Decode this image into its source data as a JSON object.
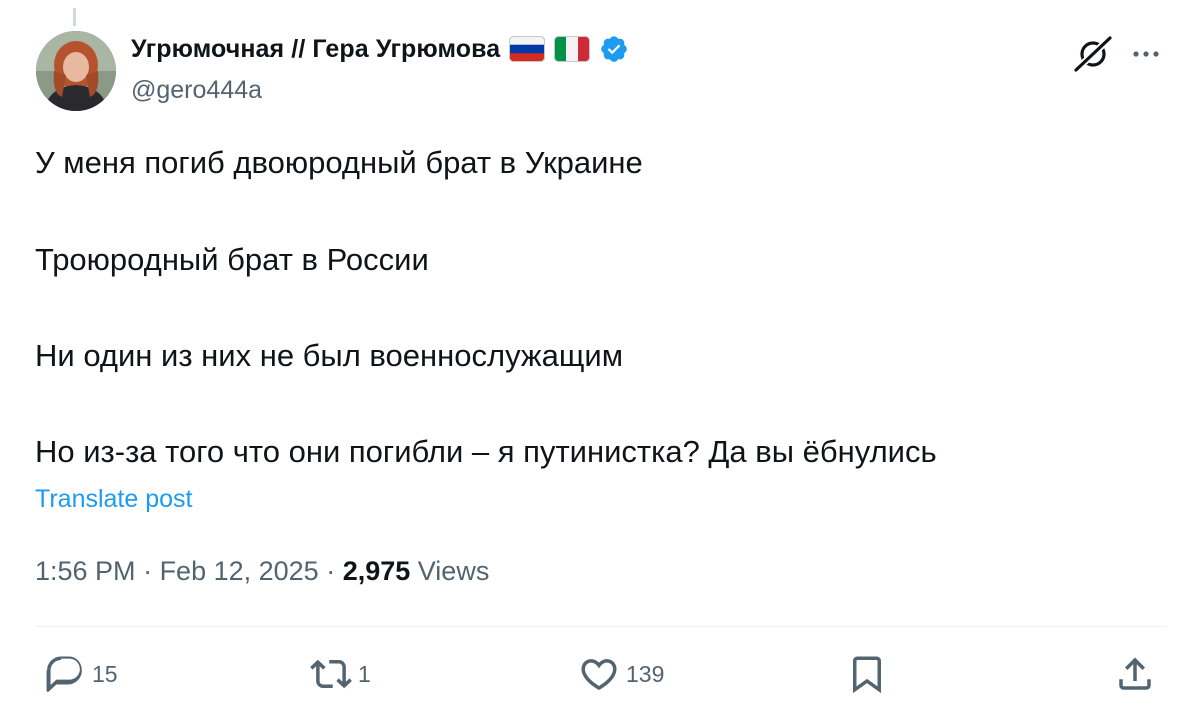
{
  "author": {
    "display_name": "Угрюмочная // Гера Угрюмова",
    "handle": "@gero444a",
    "flags": [
      "russia-flag",
      "italy-flag"
    ],
    "verified": true,
    "verified_color": "#1d9bf0"
  },
  "post": {
    "lines": [
      "У меня погиб двоюродный брат в Украине",
      "Троюродный брат в России",
      "Ни один из них не был военнослужащим",
      "Но из-за того что они погибли – я путинистка? Да вы ёбнулись"
    ],
    "translate_label": "Translate post"
  },
  "meta": {
    "time": "1:56 PM",
    "separator": " · ",
    "date": "Feb 12, 2025",
    "views_count": "2,975",
    "views_label": " Views"
  },
  "actions": {
    "replies": "15",
    "reposts": "1",
    "likes": "139"
  },
  "icons": {
    "header": [
      "grok-icon",
      "more-icon"
    ],
    "actions": [
      "reply-icon",
      "repost-icon",
      "like-icon",
      "bookmark-icon",
      "share-icon"
    ]
  },
  "colors": {
    "text": "#0f1419",
    "secondary": "#536471",
    "link": "#1d9bf0",
    "divider": "#eff3f4"
  }
}
